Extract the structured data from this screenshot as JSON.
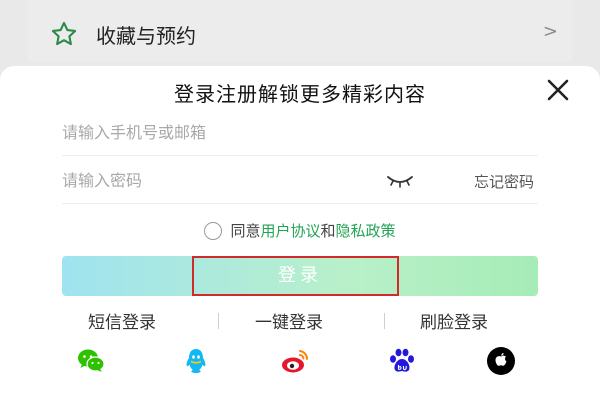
{
  "background": {
    "row_label": "收藏与预约",
    "row_chevron": ">",
    "star_icon": "star-outline-icon"
  },
  "modal": {
    "title": "登录注册解锁更多精彩内容",
    "close_icon": "close-icon",
    "phone_placeholder": "请输入手机号或邮箱",
    "password_placeholder": "请输入密码",
    "eye_icon": "eye-closed-icon",
    "forgot_label": "忘记密码",
    "agreement": {
      "prefix": "同意",
      "user_agreement": "用户协议",
      "and": "和",
      "privacy_policy": "隐私政策"
    },
    "login_label": "登录",
    "alt_logins": {
      "sms": "短信登录",
      "one_key": "一键登录",
      "face": "刷脸登录"
    },
    "social_icons": [
      "wechat-icon",
      "qq-icon",
      "weibo-icon",
      "baidu-icon",
      "apple-icon"
    ]
  },
  "colors": {
    "accent_green": "#23a455",
    "star_green": "#2c8a4a",
    "highlight_red": "#d12a2a",
    "button_gradient_start": "#9fe3f0",
    "button_gradient_end": "#a6ecb7"
  }
}
